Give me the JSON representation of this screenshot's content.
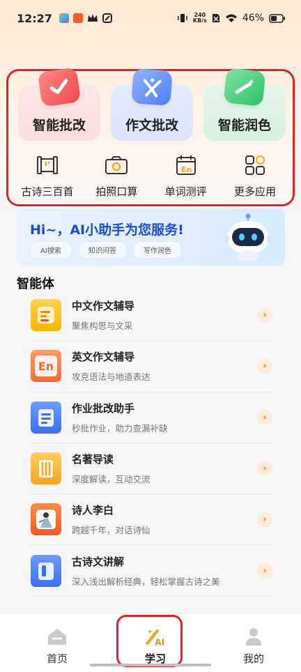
{
  "status_bar": {
    "time": "12:27",
    "net_speed_value": "240",
    "net_speed_unit": "KB/s",
    "battery": "46%"
  },
  "features": {
    "big_cards": [
      {
        "label": "智能批改"
      },
      {
        "label": "作文批改"
      },
      {
        "label": "智能润色"
      }
    ],
    "tools": [
      {
        "label": "古诗三百首"
      },
      {
        "label": "拍照口算"
      },
      {
        "label": "单词测评"
      },
      {
        "label": "更多应用"
      }
    ]
  },
  "assistant": {
    "title": "Hi~，AI小助手为您服务!",
    "tags": [
      "AI搜索",
      "知识问答",
      "写作润色"
    ]
  },
  "agents": {
    "section_title": "智能体",
    "items": [
      {
        "name": "中文作文辅导",
        "desc": "聚焦构思与文采"
      },
      {
        "name": "英文作文辅导",
        "desc": "攻克语法与地道表达",
        "icon_text": "En"
      },
      {
        "name": "作业批改助手",
        "desc": "秒批作业，助力查漏补缺"
      },
      {
        "name": "名著导读",
        "desc": "深度解读，互动交流"
      },
      {
        "name": "诗人李白",
        "desc": "跨越千年，对话诗仙"
      },
      {
        "name": "古诗文讲解",
        "desc": "深入浅出解析经典，轻松掌握古诗之美"
      }
    ]
  },
  "bottom_nav": {
    "items": [
      {
        "label": "首页"
      },
      {
        "label": "学习"
      },
      {
        "label": "我的"
      }
    ]
  },
  "colors": {
    "highlight_red": "#e3212d",
    "accent_orange": "#f08a1c",
    "assistant_blue": "#1e4ad8"
  }
}
